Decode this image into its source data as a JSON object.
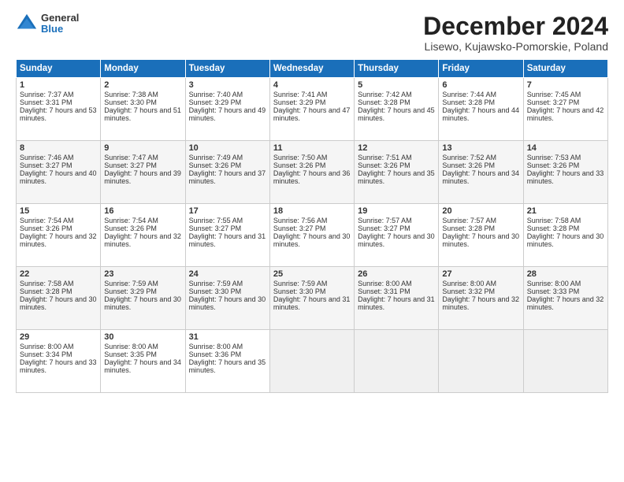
{
  "logo": {
    "general": "General",
    "blue": "Blue"
  },
  "title": "December 2024",
  "subtitle": "Lisewo, Kujawsko-Pomorskie, Poland",
  "headers": [
    "Sunday",
    "Monday",
    "Tuesday",
    "Wednesday",
    "Thursday",
    "Friday",
    "Saturday"
  ],
  "rows": [
    [
      {
        "day": "1",
        "sunrise": "Sunrise: 7:37 AM",
        "sunset": "Sunset: 3:31 PM",
        "daylight": "Daylight: 7 hours and 53 minutes."
      },
      {
        "day": "2",
        "sunrise": "Sunrise: 7:38 AM",
        "sunset": "Sunset: 3:30 PM",
        "daylight": "Daylight: 7 hours and 51 minutes."
      },
      {
        "day": "3",
        "sunrise": "Sunrise: 7:40 AM",
        "sunset": "Sunset: 3:29 PM",
        "daylight": "Daylight: 7 hours and 49 minutes."
      },
      {
        "day": "4",
        "sunrise": "Sunrise: 7:41 AM",
        "sunset": "Sunset: 3:29 PM",
        "daylight": "Daylight: 7 hours and 47 minutes."
      },
      {
        "day": "5",
        "sunrise": "Sunrise: 7:42 AM",
        "sunset": "Sunset: 3:28 PM",
        "daylight": "Daylight: 7 hours and 45 minutes."
      },
      {
        "day": "6",
        "sunrise": "Sunrise: 7:44 AM",
        "sunset": "Sunset: 3:28 PM",
        "daylight": "Daylight: 7 hours and 44 minutes."
      },
      {
        "day": "7",
        "sunrise": "Sunrise: 7:45 AM",
        "sunset": "Sunset: 3:27 PM",
        "daylight": "Daylight: 7 hours and 42 minutes."
      }
    ],
    [
      {
        "day": "8",
        "sunrise": "Sunrise: 7:46 AM",
        "sunset": "Sunset: 3:27 PM",
        "daylight": "Daylight: 7 hours and 40 minutes."
      },
      {
        "day": "9",
        "sunrise": "Sunrise: 7:47 AM",
        "sunset": "Sunset: 3:27 PM",
        "daylight": "Daylight: 7 hours and 39 minutes."
      },
      {
        "day": "10",
        "sunrise": "Sunrise: 7:49 AM",
        "sunset": "Sunset: 3:26 PM",
        "daylight": "Daylight: 7 hours and 37 minutes."
      },
      {
        "day": "11",
        "sunrise": "Sunrise: 7:50 AM",
        "sunset": "Sunset: 3:26 PM",
        "daylight": "Daylight: 7 hours and 36 minutes."
      },
      {
        "day": "12",
        "sunrise": "Sunrise: 7:51 AM",
        "sunset": "Sunset: 3:26 PM",
        "daylight": "Daylight: 7 hours and 35 minutes."
      },
      {
        "day": "13",
        "sunrise": "Sunrise: 7:52 AM",
        "sunset": "Sunset: 3:26 PM",
        "daylight": "Daylight: 7 hours and 34 minutes."
      },
      {
        "day": "14",
        "sunrise": "Sunrise: 7:53 AM",
        "sunset": "Sunset: 3:26 PM",
        "daylight": "Daylight: 7 hours and 33 minutes."
      }
    ],
    [
      {
        "day": "15",
        "sunrise": "Sunrise: 7:54 AM",
        "sunset": "Sunset: 3:26 PM",
        "daylight": "Daylight: 7 hours and 32 minutes."
      },
      {
        "day": "16",
        "sunrise": "Sunrise: 7:54 AM",
        "sunset": "Sunset: 3:26 PM",
        "daylight": "Daylight: 7 hours and 32 minutes."
      },
      {
        "day": "17",
        "sunrise": "Sunrise: 7:55 AM",
        "sunset": "Sunset: 3:27 PM",
        "daylight": "Daylight: 7 hours and 31 minutes."
      },
      {
        "day": "18",
        "sunrise": "Sunrise: 7:56 AM",
        "sunset": "Sunset: 3:27 PM",
        "daylight": "Daylight: 7 hours and 30 minutes."
      },
      {
        "day": "19",
        "sunrise": "Sunrise: 7:57 AM",
        "sunset": "Sunset: 3:27 PM",
        "daylight": "Daylight: 7 hours and 30 minutes."
      },
      {
        "day": "20",
        "sunrise": "Sunrise: 7:57 AM",
        "sunset": "Sunset: 3:28 PM",
        "daylight": "Daylight: 7 hours and 30 minutes."
      },
      {
        "day": "21",
        "sunrise": "Sunrise: 7:58 AM",
        "sunset": "Sunset: 3:28 PM",
        "daylight": "Daylight: 7 hours and 30 minutes."
      }
    ],
    [
      {
        "day": "22",
        "sunrise": "Sunrise: 7:58 AM",
        "sunset": "Sunset: 3:28 PM",
        "daylight": "Daylight: 7 hours and 30 minutes."
      },
      {
        "day": "23",
        "sunrise": "Sunrise: 7:59 AM",
        "sunset": "Sunset: 3:29 PM",
        "daylight": "Daylight: 7 hours and 30 minutes."
      },
      {
        "day": "24",
        "sunrise": "Sunrise: 7:59 AM",
        "sunset": "Sunset: 3:30 PM",
        "daylight": "Daylight: 7 hours and 30 minutes."
      },
      {
        "day": "25",
        "sunrise": "Sunrise: 7:59 AM",
        "sunset": "Sunset: 3:30 PM",
        "daylight": "Daylight: 7 hours and 31 minutes."
      },
      {
        "day": "26",
        "sunrise": "Sunrise: 8:00 AM",
        "sunset": "Sunset: 3:31 PM",
        "daylight": "Daylight: 7 hours and 31 minutes."
      },
      {
        "day": "27",
        "sunrise": "Sunrise: 8:00 AM",
        "sunset": "Sunset: 3:32 PM",
        "daylight": "Daylight: 7 hours and 32 minutes."
      },
      {
        "day": "28",
        "sunrise": "Sunrise: 8:00 AM",
        "sunset": "Sunset: 3:33 PM",
        "daylight": "Daylight: 7 hours and 32 minutes."
      }
    ],
    [
      {
        "day": "29",
        "sunrise": "Sunrise: 8:00 AM",
        "sunset": "Sunset: 3:34 PM",
        "daylight": "Daylight: 7 hours and 33 minutes."
      },
      {
        "day": "30",
        "sunrise": "Sunrise: 8:00 AM",
        "sunset": "Sunset: 3:35 PM",
        "daylight": "Daylight: 7 hours and 34 minutes."
      },
      {
        "day": "31",
        "sunrise": "Sunrise: 8:00 AM",
        "sunset": "Sunset: 3:36 PM",
        "daylight": "Daylight: 7 hours and 35 minutes."
      },
      null,
      null,
      null,
      null
    ]
  ]
}
